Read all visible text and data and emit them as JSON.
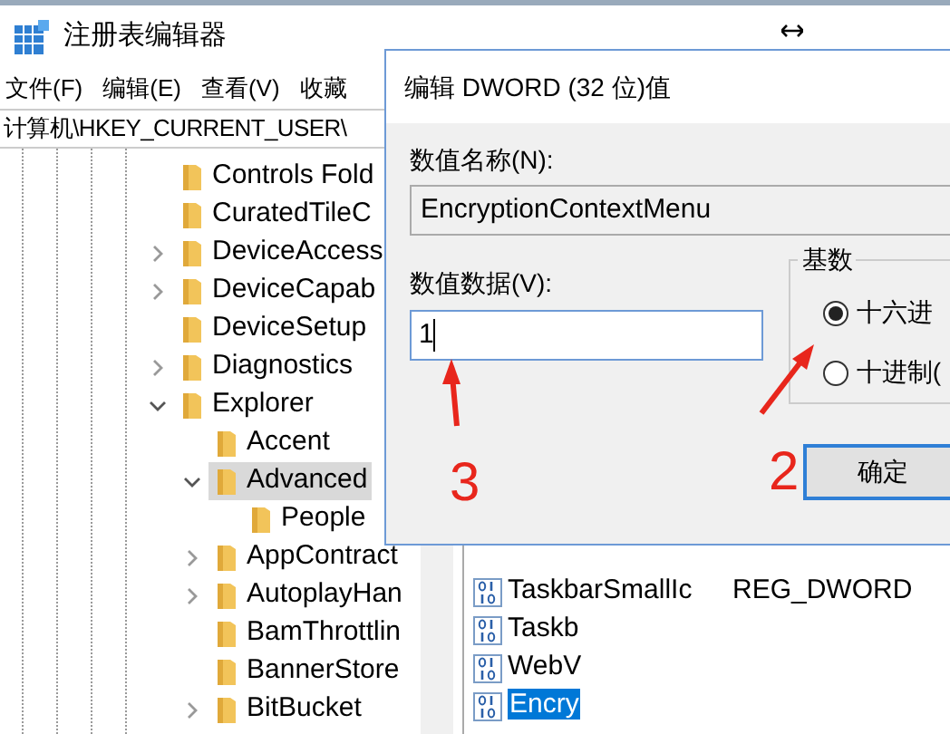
{
  "window": {
    "title": "注册表编辑器"
  },
  "menu": [
    "文件(F)",
    "编辑(E)",
    "查看(V)",
    "收藏"
  ],
  "address": "计算机\\HKEY_CURRENT_USER\\",
  "tree": [
    {
      "label": "Controls Fold",
      "selected": false
    },
    {
      "label": "CuratedTileC",
      "selected": false
    },
    {
      "label": "DeviceAccess",
      "selected": false,
      "expanded": false
    },
    {
      "label": "DeviceCapab",
      "selected": false,
      "expanded": false
    },
    {
      "label": "DeviceSetup",
      "selected": false
    },
    {
      "label": "Diagnostics",
      "selected": false,
      "expanded": false
    },
    {
      "label": "Explorer",
      "selected": false,
      "expanded": true,
      "children": [
        {
          "label": "Accent",
          "selected": false
        },
        {
          "label": "Advanced",
          "selected": true,
          "expanded": true,
          "children": [
            {
              "label": "People",
              "selected": false
            }
          ]
        },
        {
          "label": "AppContract",
          "selected": false,
          "expanded": false
        },
        {
          "label": "AutoplayHan",
          "selected": false,
          "expanded": false
        },
        {
          "label": "BamThrottlin",
          "selected": false
        },
        {
          "label": "BannerStore",
          "selected": false
        },
        {
          "label": "BitBucket",
          "selected": false,
          "expanded": false
        }
      ]
    }
  ],
  "values": [
    {
      "name": "TaskbarSmallIc",
      "type": "REG_DWORD",
      "selected": false
    },
    {
      "name": "Taskb",
      "selected": false
    },
    {
      "name": "WebV",
      "selected": false
    },
    {
      "name": "Encry",
      "selected": true
    }
  ],
  "dialog": {
    "title": "编辑 DWORD (32 位)值",
    "name_label": "数值名称(N):",
    "name_value": "EncryptionContextMenu",
    "data_label": "数值数据(V):",
    "data_value": "1",
    "radix": {
      "label": "基数",
      "options": [
        {
          "label": "十六进",
          "selected": true
        },
        {
          "label": "十进制(",
          "selected": false
        }
      ]
    },
    "ok": "确定"
  },
  "annotations": [
    {
      "label": "3"
    },
    {
      "label": "2"
    }
  ]
}
